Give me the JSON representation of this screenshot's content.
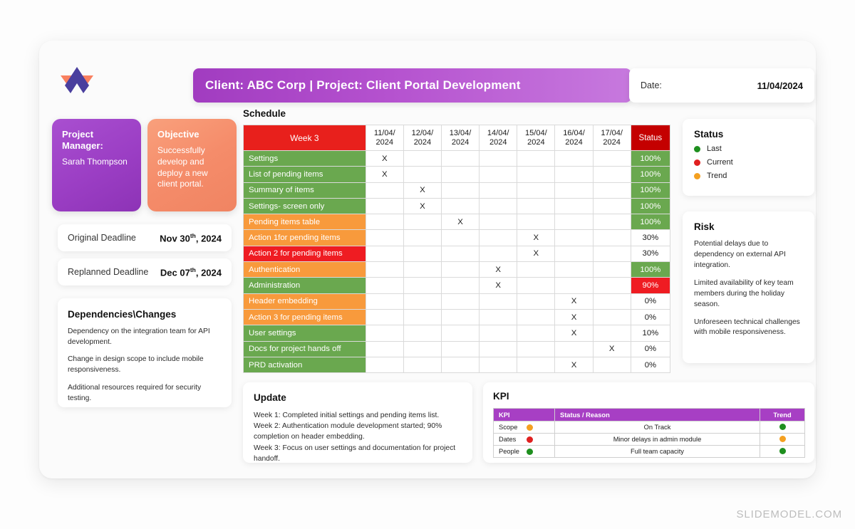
{
  "brand": {
    "logo_name": "slidemodel-logo",
    "footer": "SLIDEMODEL.COM"
  },
  "header": {
    "title": "Client: ABC Corp | Project: Client Portal Development",
    "date_label": "Date:",
    "date_value": "11/04/2024"
  },
  "project_manager": {
    "heading": "Project Manager:",
    "name": "Sarah Thompson"
  },
  "objective": {
    "heading": "Objective",
    "text": "Successfully develop and deploy a new client portal."
  },
  "deadlines": [
    {
      "label": "Original Deadline",
      "month": "Nov",
      "day": "30",
      "ord": "th",
      "year": ", 2024"
    },
    {
      "label": "Replanned Deadline",
      "month": "Dec",
      "day": "07",
      "ord": "th",
      "year": ", 2024"
    }
  ],
  "dependencies": {
    "title": "Dependencies\\Changes",
    "items": [
      "Dependency on the integration team for API development.",
      "Change in design scope to include mobile responsiveness.",
      "Additional resources required for security testing."
    ]
  },
  "schedule": {
    "section_label": "Schedule",
    "week_header": "Week 3",
    "status_header": "Status",
    "dates": [
      "11/04/ 2024",
      "12/04/ 2024",
      "13/04/ 2024",
      "14/04/ 2024",
      "15/04/ 2024",
      "16/04/ 2024",
      "17/04/ 2024"
    ],
    "mark": "X",
    "rows": [
      {
        "task": "Settings",
        "task_color": "green",
        "marks": [
          1,
          0,
          0,
          0,
          0,
          0,
          0
        ],
        "status": "100%",
        "status_color": "green"
      },
      {
        "task": "List of pending items",
        "task_color": "green",
        "marks": [
          1,
          0,
          0,
          0,
          0,
          0,
          0
        ],
        "status": "100%",
        "status_color": "green"
      },
      {
        "task": "Summary of items",
        "task_color": "green",
        "marks": [
          0,
          1,
          0,
          0,
          0,
          0,
          0
        ],
        "status": "100%",
        "status_color": "green"
      },
      {
        "task": "Settings- screen only",
        "task_color": "green",
        "marks": [
          0,
          1,
          0,
          0,
          0,
          0,
          0
        ],
        "status": "100%",
        "status_color": "green"
      },
      {
        "task": "Pending items table",
        "task_color": "orange",
        "marks": [
          0,
          0,
          1,
          0,
          0,
          0,
          0
        ],
        "status": "100%",
        "status_color": "green"
      },
      {
        "task": "Action 1for pending items",
        "task_color": "orange",
        "marks": [
          0,
          0,
          0,
          0,
          1,
          0,
          0
        ],
        "status": "30%",
        "status_color": "white"
      },
      {
        "task": "Action 2 for pending items",
        "task_color": "red",
        "marks": [
          0,
          0,
          0,
          0,
          1,
          0,
          0
        ],
        "status": "30%",
        "status_color": "white"
      },
      {
        "task": "Authentication",
        "task_color": "orange",
        "marks": [
          0,
          0,
          0,
          1,
          0,
          0,
          0
        ],
        "status": "100%",
        "status_color": "green"
      },
      {
        "task": "Administration",
        "task_color": "green",
        "marks": [
          0,
          0,
          0,
          1,
          0,
          0,
          0
        ],
        "status": "90%",
        "status_color": "red"
      },
      {
        "task": "Header embedding",
        "task_color": "orange",
        "marks": [
          0,
          0,
          0,
          0,
          0,
          1,
          0
        ],
        "status": "0%",
        "status_color": "white"
      },
      {
        "task": "Action 3 for pending items",
        "task_color": "orange",
        "marks": [
          0,
          0,
          0,
          0,
          0,
          1,
          0
        ],
        "status": "0%",
        "status_color": "white"
      },
      {
        "task": "User settings",
        "task_color": "green",
        "marks": [
          0,
          0,
          0,
          0,
          0,
          1,
          0
        ],
        "status": "10%",
        "status_color": "white"
      },
      {
        "task": "Docs for project hands off",
        "task_color": "green",
        "marks": [
          0,
          0,
          0,
          0,
          0,
          0,
          1
        ],
        "status": "0%",
        "status_color": "white"
      },
      {
        "task": "PRD activation",
        "task_color": "green",
        "marks": [
          0,
          0,
          0,
          0,
          0,
          1,
          0
        ],
        "status": "0%",
        "status_color": "white"
      }
    ]
  },
  "status_legend": {
    "title": "Status",
    "items": [
      {
        "label": "Last",
        "color": "#1e8f1e"
      },
      {
        "label": "Current",
        "color": "#e02020"
      },
      {
        "label": "Trend",
        "color": "#f4a020"
      }
    ]
  },
  "risk": {
    "title": "Risk",
    "items": [
      "Potential delays due to dependency on external API integration.",
      "Limited availability of key team members during the holiday season.",
      "Unforeseen technical challenges with mobile responsiveness."
    ]
  },
  "update": {
    "title": "Update",
    "lines": [
      "Week 1: Completed initial settings and pending items list.",
      "Week 2: Authentication module development started; 90% completion on header embedding.",
      "Week 3: Focus on user settings and documentation for project handoff."
    ]
  },
  "kpi": {
    "title": "KPI",
    "columns": [
      "KPI",
      "Status / Reason",
      "Trend"
    ],
    "rows": [
      {
        "name": "Scope",
        "name_color": "#f4a020",
        "reason": "On Track",
        "trend_color": "#1e8f1e"
      },
      {
        "name": "Dates",
        "name_color": "#e02020",
        "reason": "Minor delays in admin module",
        "trend_color": "#f4a020"
      },
      {
        "name": "People",
        "name_color": "#1e8f1e",
        "reason": "Full team capacity",
        "trend_color": "#1e8f1e"
      }
    ]
  },
  "colors": {
    "brand_purple": "#a73fc4",
    "brand_orange": "#f58c6a",
    "green": "#6aa84f",
    "red": "#ef1c22",
    "orange": "#f89a3c"
  }
}
